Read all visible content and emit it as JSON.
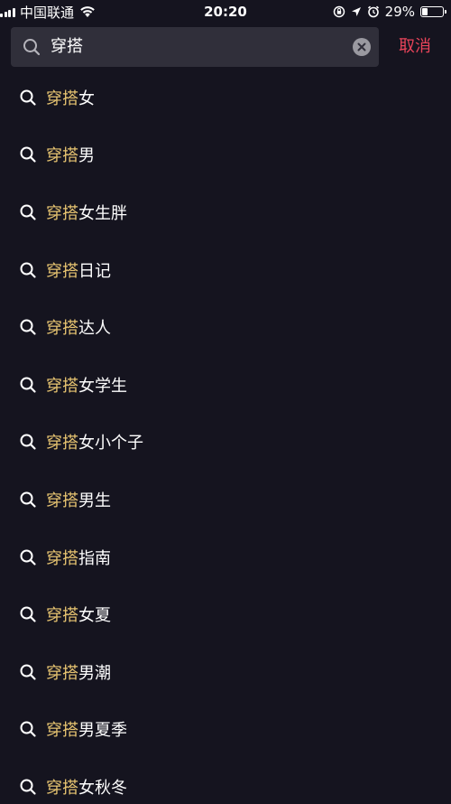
{
  "status_bar": {
    "carrier": "中国联通",
    "time": "20:20",
    "battery_percent": "29%",
    "battery_level": 0.29,
    "icons": [
      "signal-icon",
      "wifi-icon",
      "screen-rotation-lock-icon",
      "location-icon",
      "alarm-icon",
      "battery-icon"
    ]
  },
  "search": {
    "query": "穿搭",
    "cancel_label": "取消"
  },
  "accent_colors": {
    "highlight": "#e8c571",
    "cancel": "#e9445a",
    "background": "#15141f",
    "search_box": "#302f3a"
  },
  "suggestions": [
    {
      "highlight": "穿搭",
      "rest": "女"
    },
    {
      "highlight": "穿搭",
      "rest": "男"
    },
    {
      "highlight": "穿搭",
      "rest": "女生胖"
    },
    {
      "highlight": "穿搭",
      "rest": "日记"
    },
    {
      "highlight": "穿搭",
      "rest": "达人"
    },
    {
      "highlight": "穿搭",
      "rest": "女学生"
    },
    {
      "highlight": "穿搭",
      "rest": "女小个子"
    },
    {
      "highlight": "穿搭",
      "rest": "男生"
    },
    {
      "highlight": "穿搭",
      "rest": "指南"
    },
    {
      "highlight": "穿搭",
      "rest": "女夏"
    },
    {
      "highlight": "穿搭",
      "rest": "男潮"
    },
    {
      "highlight": "穿搭",
      "rest": "男夏季"
    },
    {
      "highlight": "穿搭",
      "rest": "女秋冬"
    }
  ]
}
